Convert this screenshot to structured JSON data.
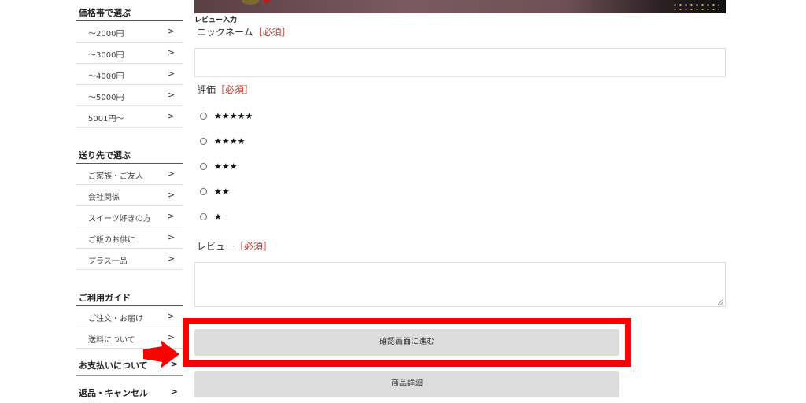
{
  "sidebar": {
    "price_section": {
      "title": "価格帯で選ぶ",
      "items": [
        {
          "label": "～2000円",
          "chevron": ">"
        },
        {
          "label": "～3000円",
          "chevron": ">"
        },
        {
          "label": "～4000円",
          "chevron": ">"
        },
        {
          "label": "～5000円",
          "chevron": ">"
        },
        {
          "label": "5001円～",
          "chevron": ">"
        }
      ]
    },
    "recipient_section": {
      "title": "送り先で選ぶ",
      "items": [
        {
          "label": "ご家族・ご友人",
          "chevron": ">"
        },
        {
          "label": "会社関係",
          "chevron": ">"
        },
        {
          "label": "スイーツ好きの方",
          "chevron": ">"
        },
        {
          "label": "ご飯のお供に",
          "chevron": ">"
        },
        {
          "label": "プラス一品",
          "chevron": ">"
        }
      ]
    },
    "guide_section": {
      "title": "ご利用ガイド",
      "items": [
        {
          "label": "ご注文・お届け",
          "chevron": ">"
        },
        {
          "label": "送料について",
          "chevron": ">"
        }
      ],
      "extra_items": [
        {
          "label": "お支払いについて",
          "chevron": ">"
        },
        {
          "label": "返品・キャンセル",
          "chevron": ">"
        }
      ]
    }
  },
  "review_form": {
    "section_label": "レビュー入力",
    "nickname": {
      "label": "ニックネーム",
      "required": "［必須］",
      "value": ""
    },
    "rating": {
      "label": "評価",
      "required": "［必須］",
      "options": [
        {
          "stars": "★★★★★",
          "checked": false
        },
        {
          "stars": "★★★★",
          "checked": false
        },
        {
          "stars": "★★★",
          "checked": false
        },
        {
          "stars": "★★",
          "checked": false
        },
        {
          "stars": "★",
          "checked": false
        }
      ]
    },
    "review": {
      "label": "レビュー",
      "required": "［必須］",
      "value": ""
    },
    "confirm_button": "確認画面に進む",
    "details_button": "商品詳細"
  },
  "annotation": {
    "highlight_color": "#ff0000",
    "arrow_icon": "arrow-right-icon"
  }
}
